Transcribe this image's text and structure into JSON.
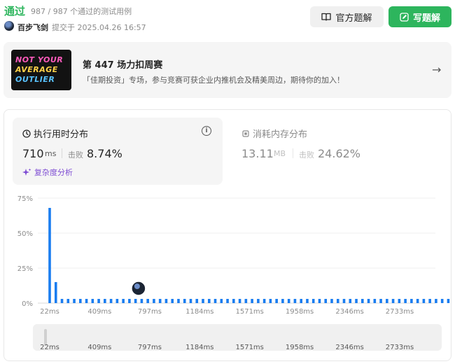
{
  "header": {
    "status": "通过",
    "cases": "987 / 987 个通过的测试用例",
    "user": "百步飞剑",
    "submit_time": "提交于 2025.04.26 16:57",
    "official_solution": "官方题解",
    "write_solution": "写题解"
  },
  "contest": {
    "image_lines": [
      "NOT YOUR",
      "AVERAGE",
      "OUTLIER"
    ],
    "title": "第 447 场力扣周赛",
    "description": "「佳期投资」专场，参与竞赛可获企业内推机会及精美周边，期待你的加入！"
  },
  "runtime": {
    "title": "执行用时分布",
    "value": "710",
    "unit": "ms",
    "beat_label": "击败",
    "beat": "8.74%",
    "complexity_link": "复杂度分析"
  },
  "memory": {
    "title": "消耗内存分布",
    "value": "13.11",
    "unit": "MB",
    "beat_label": "击败",
    "beat": "24.62%"
  },
  "colors": {
    "accent_green": "#2db55d",
    "bar_blue": "#1a7df0",
    "purple": "#7e4dd3"
  },
  "chart_data": {
    "type": "bar",
    "title": "",
    "xlabel": "",
    "ylabel": "",
    "ylim": [
      0,
      75
    ],
    "yticks": [
      "75%",
      "50%",
      "25%",
      "0%"
    ],
    "ytick_values": [
      75,
      50,
      25,
      0
    ],
    "xticks": [
      "22ms",
      "409ms",
      "797ms",
      "1184ms",
      "1571ms",
      "1958ms",
      "2346ms",
      "2733ms"
    ],
    "xtick_values": [
      22,
      409,
      797,
      1184,
      1571,
      1958,
      2346,
      2733
    ],
    "xlim": [
      0,
      3060
    ],
    "bar_start": 22,
    "bar_step": 47.5,
    "values": [
      68,
      15,
      3,
      3,
      3,
      3,
      3,
      3,
      3,
      3,
      3,
      3,
      3,
      3,
      3,
      3,
      3,
      3,
      3,
      3,
      3,
      3,
      3,
      3,
      3,
      3,
      3,
      3,
      3,
      3,
      3,
      3,
      3,
      3,
      3,
      3,
      3,
      3,
      3,
      3,
      3,
      3,
      3,
      3,
      3,
      3,
      3,
      3,
      3,
      3,
      3,
      3,
      3,
      3,
      3,
      3,
      3,
      3,
      3,
      3,
      3,
      3,
      3,
      3,
      3,
      3
    ],
    "user_marker": 710
  }
}
